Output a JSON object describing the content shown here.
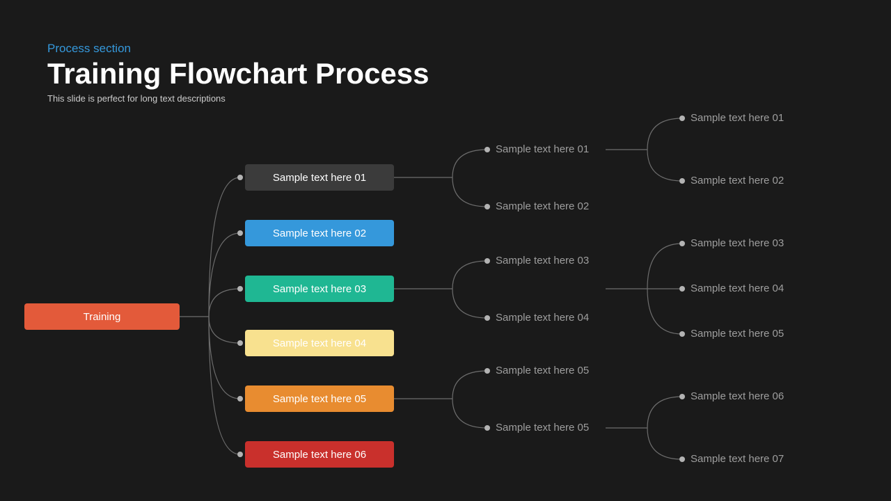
{
  "header": {
    "eyebrow": "Process section",
    "title": "Training Flowchart Process",
    "subtitle": "This slide is perfect for long text descriptions"
  },
  "root": {
    "label": "Training"
  },
  "level1": [
    {
      "label": "Sample text here 01",
      "fill": "#3b3b3b",
      "text": "#ffffff"
    },
    {
      "label": "Sample text here 02",
      "fill": "#3598db",
      "text": "#ffffff"
    },
    {
      "label": "Sample text here 03",
      "fill": "#1fb793",
      "text": "#ffffff"
    },
    {
      "label": "Sample text here 04",
      "fill": "#f8e18f",
      "text": "#ffffff"
    },
    {
      "label": "Sample text here 05",
      "fill": "#e88c30",
      "text": "#ffffff"
    },
    {
      "label": "Sample text here 06",
      "fill": "#c9302c",
      "text": "#ffffff"
    }
  ],
  "branchA": {
    "items": [
      "Sample text here 01",
      "Sample text here 02"
    ]
  },
  "branchB": {
    "items": [
      "Sample text here 03",
      "Sample text here 04"
    ]
  },
  "branchC": {
    "items": [
      "Sample text here 05",
      "Sample text here 05"
    ]
  },
  "farA": {
    "items": [
      "Sample text here 01",
      "Sample text here 02"
    ]
  },
  "farB": {
    "items": [
      "Sample text here 03",
      "Sample text here 04",
      "Sample text here 05"
    ]
  },
  "farC": {
    "items": [
      "Sample text here 06",
      "Sample text here 07"
    ]
  },
  "colors": {
    "line": "#6d6d6d",
    "dot": "#b3b3b3"
  }
}
